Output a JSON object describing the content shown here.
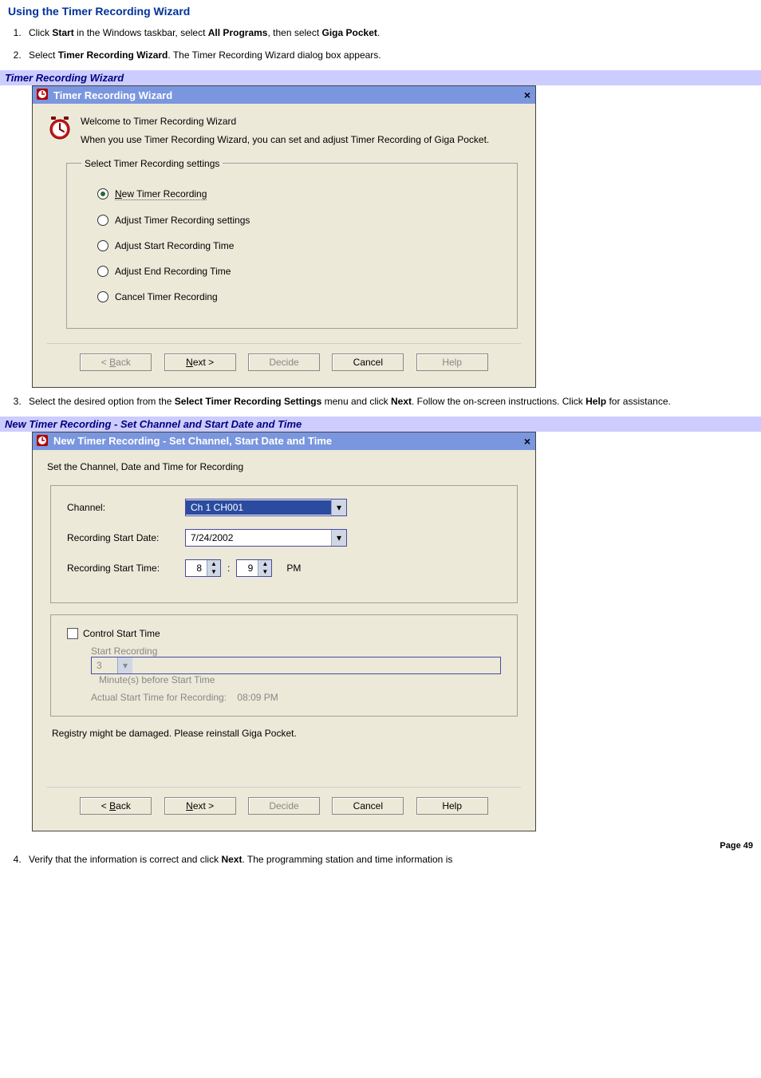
{
  "heading": "Using the Timer Recording Wizard",
  "steps": {
    "1_pre": "Click ",
    "1_b1": "Start",
    "1_mid1": " in the Windows taskbar, select ",
    "1_b2": "All Programs",
    "1_mid2": ", then select ",
    "1_b3": "Giga Pocket",
    "1_post": ".",
    "2_pre": "Select ",
    "2_b1": "Timer Recording Wizard",
    "2_post": ". The Timer Recording Wizard dialog box appears.",
    "3_pre": "Select the desired option from the ",
    "3_b1": "Select Timer Recording Settings",
    "3_mid1": " menu and click ",
    "3_b2": "Next",
    "3_mid2": ". Follow the on-screen instructions. Click ",
    "3_b3": "Help",
    "3_post": " for assistance.",
    "4_pre": "Verify that the information is correct and click ",
    "4_b1": "Next",
    "4_post": ". The programming station and time information is"
  },
  "caption1": "Timer Recording Wizard",
  "caption2": "New Timer Recording - Set Channel and Start Date and Time",
  "wiz1": {
    "title": "Timer Recording Wizard",
    "intro_line1": "Welcome to Timer Recording Wizard",
    "intro_line2": "When you use Timer Recording Wizard, you can set and adjust Timer Recording of Giga Pocket.",
    "group_legend": "Select Timer Recording settings",
    "opt_new": "ew Timer Recording",
    "opt_new_u": "N",
    "opt_adjust_settings": "Adjust Timer Recording settings",
    "opt_adjust_start": "Adjust Start Recording Time",
    "opt_adjust_end": "Adjust End Recording Time",
    "opt_cancel": "Cancel Timer Recording"
  },
  "wiz2": {
    "title": "New Timer Recording - Set Channel, Start Date and Time",
    "subhead": "Set the Channel, Date and Time for Recording",
    "lbl_channel": "Channel:",
    "val_channel": "Ch 1 CH001",
    "lbl_startdate": "Recording Start Date:",
    "val_startdate": "7/24/2002",
    "lbl_starttime": "Recording Start Time:",
    "val_hour": "8",
    "val_min": "9",
    "ampm": "PM",
    "chk_control": "Control Start Time",
    "lbl_startrec": "Start Recording",
    "val_startrec": "3",
    "lbl_minbefore": "Minute(s) before Start Time",
    "lbl_actual": "Actual Start Time for Recording:",
    "val_actual": "08:09 PM",
    "status": "Registry might be damaged. Please reinstall Giga Pocket."
  },
  "buttons": {
    "back_u": "B",
    "back": "ack",
    "next_u": "N",
    "next": "ext >",
    "decide": "Decide",
    "cancel": "Cancel",
    "help": "Help"
  },
  "footer": "Page 49"
}
